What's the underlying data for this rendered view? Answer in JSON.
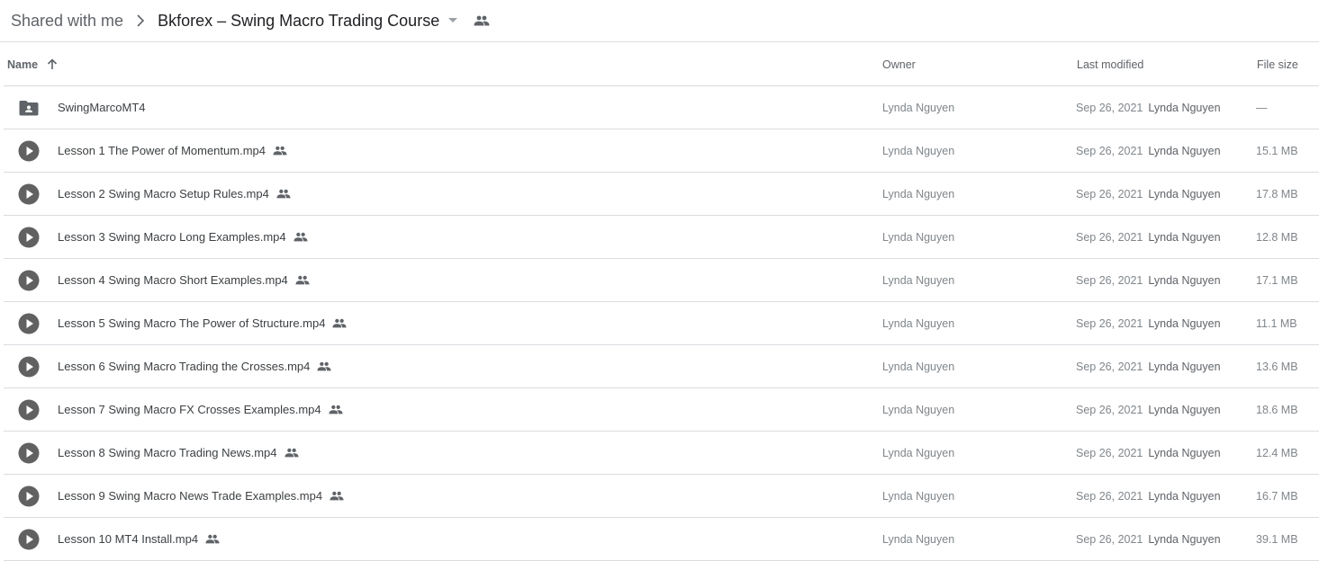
{
  "breadcrumb": {
    "root": "Shared with me",
    "current": "Bkforex – Swing Macro Trading Course"
  },
  "icons": {
    "separator": "chevron-right-icon",
    "caret": "caret-down-icon",
    "shared": "people-icon",
    "sort": "arrow-up-icon",
    "folder": "shared-folder-icon",
    "video": "video-play-icon"
  },
  "columns": {
    "name": "Name",
    "owner": "Owner",
    "modified": "Last modified",
    "size": "File size"
  },
  "rows": [
    {
      "type": "folder",
      "name": "SwingMarcoMT4",
      "shared": false,
      "owner": "Lynda Nguyen",
      "modified_date": "Sep 26, 2021",
      "modified_by": "Lynda Nguyen",
      "size": "—"
    },
    {
      "type": "video",
      "name": "Lesson 1 The Power of Momentum.mp4",
      "shared": true,
      "owner": "Lynda Nguyen",
      "modified_date": "Sep 26, 2021",
      "modified_by": "Lynda Nguyen",
      "size": "15.1 MB"
    },
    {
      "type": "video",
      "name": "Lesson 2 Swing Macro Setup Rules.mp4",
      "shared": true,
      "owner": "Lynda Nguyen",
      "modified_date": "Sep 26, 2021",
      "modified_by": "Lynda Nguyen",
      "size": "17.8 MB"
    },
    {
      "type": "video",
      "name": "Lesson 3 Swing Macro Long Examples.mp4",
      "shared": true,
      "owner": "Lynda Nguyen",
      "modified_date": "Sep 26, 2021",
      "modified_by": "Lynda Nguyen",
      "size": "12.8 MB"
    },
    {
      "type": "video",
      "name": "Lesson 4 Swing Macro Short Examples.mp4",
      "shared": true,
      "owner": "Lynda Nguyen",
      "modified_date": "Sep 26, 2021",
      "modified_by": "Lynda Nguyen",
      "size": "17.1 MB"
    },
    {
      "type": "video",
      "name": "Lesson 5 Swing Macro The Power of Structure.mp4",
      "shared": true,
      "owner": "Lynda Nguyen",
      "modified_date": "Sep 26, 2021",
      "modified_by": "Lynda Nguyen",
      "size": "11.1 MB"
    },
    {
      "type": "video",
      "name": "Lesson 6 Swing Macro Trading the Crosses.mp4",
      "shared": true,
      "owner": "Lynda Nguyen",
      "modified_date": "Sep 26, 2021",
      "modified_by": "Lynda Nguyen",
      "size": "13.6 MB"
    },
    {
      "type": "video",
      "name": "Lesson 7 Swing Macro FX Crosses Examples.mp4",
      "shared": true,
      "owner": "Lynda Nguyen",
      "modified_date": "Sep 26, 2021",
      "modified_by": "Lynda Nguyen",
      "size": "18.6 MB"
    },
    {
      "type": "video",
      "name": "Lesson 8 Swing Macro Trading News.mp4",
      "shared": true,
      "owner": "Lynda Nguyen",
      "modified_date": "Sep 26, 2021",
      "modified_by": "Lynda Nguyen",
      "size": "12.4 MB"
    },
    {
      "type": "video",
      "name": "Lesson 9 Swing Macro News Trade Examples.mp4",
      "shared": true,
      "owner": "Lynda Nguyen",
      "modified_date": "Sep 26, 2021",
      "modified_by": "Lynda Nguyen",
      "size": "16.7 MB"
    },
    {
      "type": "video",
      "name": "Lesson 10 MT4 Install.mp4",
      "shared": true,
      "owner": "Lynda Nguyen",
      "modified_date": "Sep 26, 2021",
      "modified_by": "Lynda Nguyen",
      "size": "39.1 MB"
    }
  ],
  "colors": {
    "text_primary": "#202124",
    "text_secondary": "#5f6368",
    "text_muted": "#80868b",
    "divider": "#dadce0",
    "icon": "#5f6368"
  }
}
